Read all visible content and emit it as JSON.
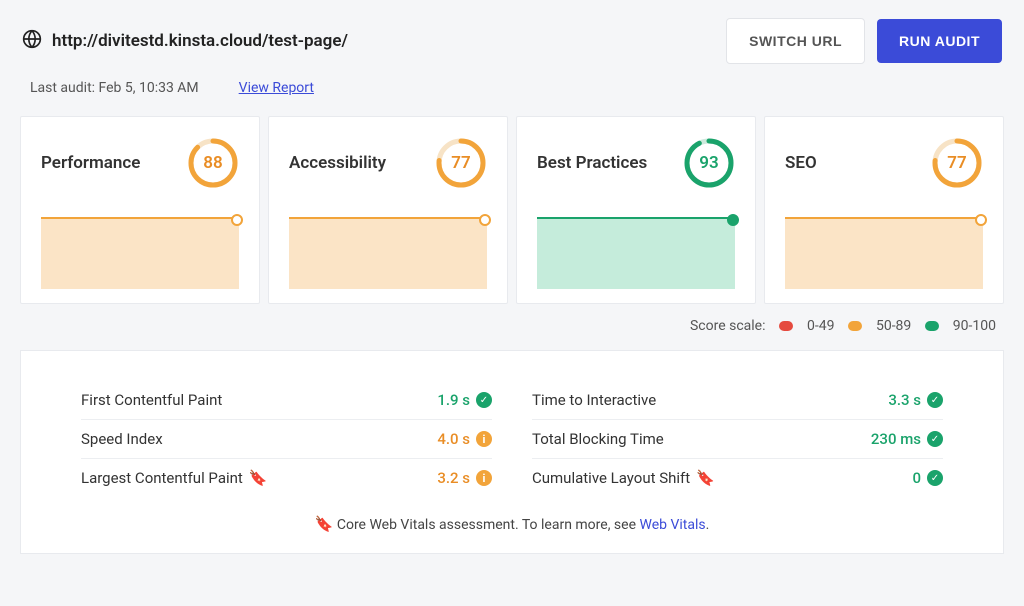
{
  "header": {
    "url": "http://divitestd.kinsta.cloud/test-page/",
    "switch_label": "SWITCH URL",
    "run_label": "RUN AUDIT"
  },
  "subheader": {
    "last_audit": "Last audit: Feb 5, 10:33 AM",
    "view_report": "View Report"
  },
  "cards": [
    {
      "title": "Performance",
      "score": 88,
      "level": "orange"
    },
    {
      "title": "Accessibility",
      "score": 77,
      "level": "orange"
    },
    {
      "title": "Best Practices",
      "score": 93,
      "level": "green"
    },
    {
      "title": "SEO",
      "score": 77,
      "level": "orange"
    }
  ],
  "scale": {
    "label": "Score scale:",
    "ranges": [
      "0-49",
      "50-89",
      "90-100"
    ]
  },
  "metrics": {
    "left": [
      {
        "label": "First Contentful Paint",
        "value": "1.9 s",
        "color": "green",
        "icon": "check",
        "flag": false
      },
      {
        "label": "Speed Index",
        "value": "4.0 s",
        "color": "orange",
        "icon": "info",
        "flag": false
      },
      {
        "label": "Largest Contentful Paint",
        "value": "3.2 s",
        "color": "orange",
        "icon": "info",
        "flag": true
      }
    ],
    "right": [
      {
        "label": "Time to Interactive",
        "value": "3.3 s",
        "color": "green",
        "icon": "check",
        "flag": false
      },
      {
        "label": "Total Blocking Time",
        "value": "230 ms",
        "color": "green",
        "icon": "check",
        "flag": false
      },
      {
        "label": "Cumulative Layout Shift",
        "value": "0",
        "color": "green",
        "icon": "check",
        "flag": true
      }
    ]
  },
  "footnote": {
    "text_before": "Core Web Vitals assessment. To learn more, see ",
    "link_text": "Web Vitals",
    "text_after": "."
  },
  "colors": {
    "orange": "#f2a43a",
    "green": "#1aa36b",
    "red": "#e54a3f",
    "primary": "#3b4bd8"
  }
}
